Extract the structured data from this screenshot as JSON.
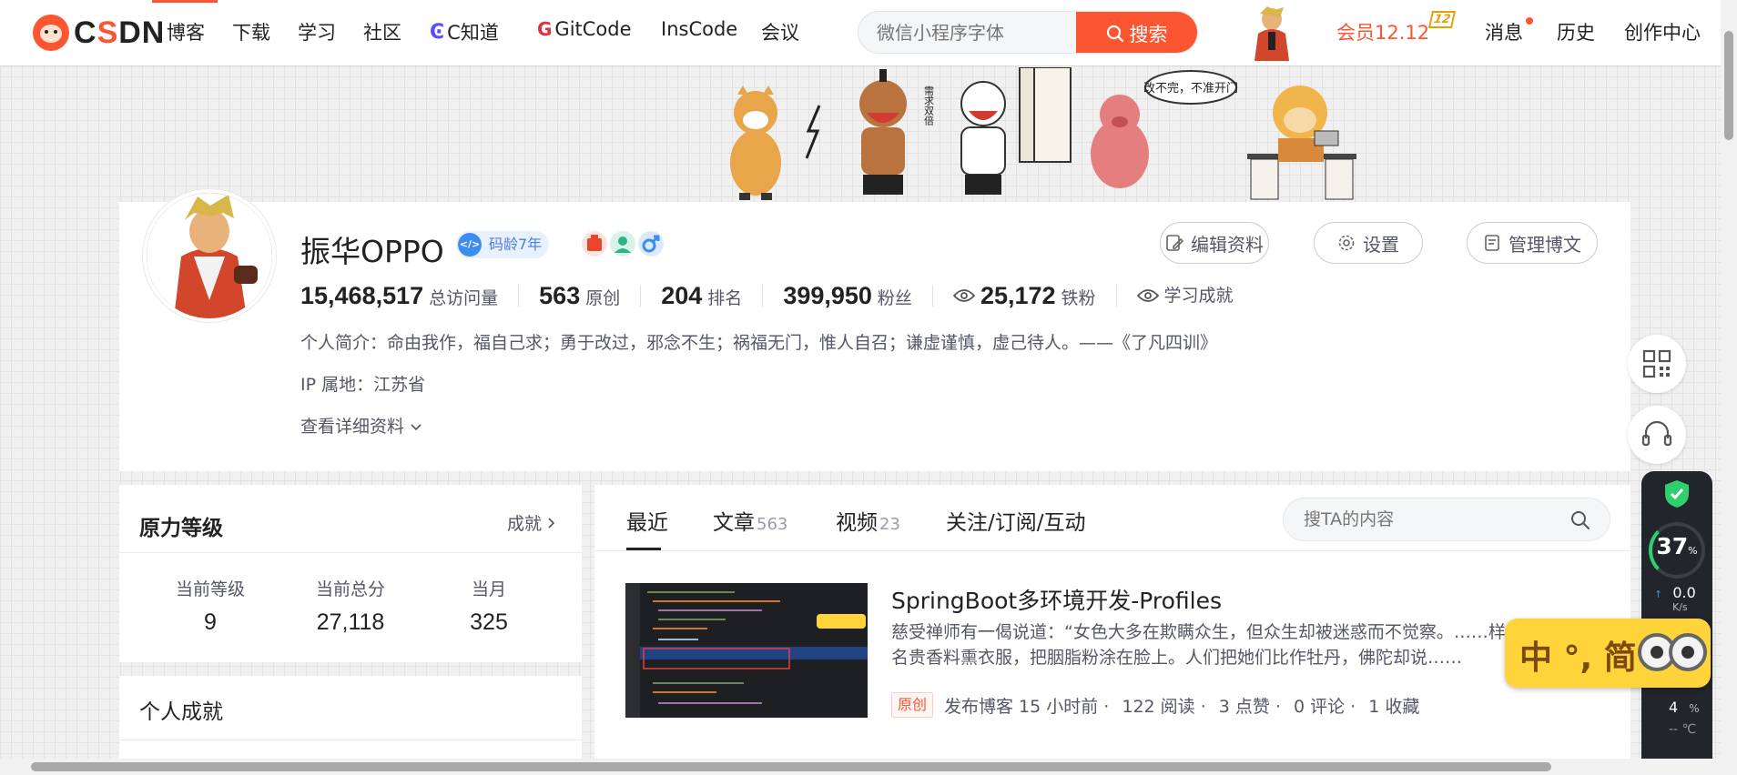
{
  "nav": {
    "items": [
      {
        "label": "博客"
      },
      {
        "label": "下载"
      },
      {
        "label": "学习"
      },
      {
        "label": "社区"
      },
      {
        "label": "C知道"
      },
      {
        "label": "GitCode"
      },
      {
        "label": "InsCode"
      },
      {
        "label": "会议"
      }
    ],
    "search_placeholder": "微信小程序字体",
    "search_button": "搜索",
    "vip_label": "会员12.12",
    "vip_badge": "12",
    "right_items": [
      "消息",
      "历史",
      "创作中心"
    ],
    "accent_color": "#fc5531"
  },
  "banner": {
    "speech": "改不完，不准开门",
    "sign": "需求双倍"
  },
  "profile": {
    "username": "振华OPPO",
    "coding_age": "码龄7年",
    "buttons": [
      "编辑资料",
      "设置",
      "管理博文"
    ],
    "stats": [
      {
        "value": "15,468,517",
        "label": "总访问量"
      },
      {
        "value": "563",
        "label": "原创"
      },
      {
        "value": "204",
        "label": "排名"
      },
      {
        "value": "399,950",
        "label": "粉丝"
      },
      {
        "value": "25,172",
        "label": "铁粉"
      }
    ],
    "learning": "学习成就",
    "intro": "个人简介：命由我作，福自己求；勇于改过，邪念不生；祸福无门，惟人自召；谦虚谨慎，虚己待人。——《了凡四训》",
    "ip": "IP 属地：江苏省",
    "more": "查看详细资料"
  },
  "level": {
    "title": "原力等级",
    "link": "成就",
    "columns": [
      {
        "label": "当前等级",
        "value": "9"
      },
      {
        "label": "当前总分",
        "value": "27,118"
      },
      {
        "label": "当月",
        "value": "325"
      }
    ]
  },
  "achieve": {
    "title": "个人成就"
  },
  "content": {
    "tabs": [
      {
        "label": "最近",
        "count": ""
      },
      {
        "label": "文章",
        "count": "563"
      },
      {
        "label": "视频",
        "count": "23"
      },
      {
        "label": "关注/订阅/互动",
        "count": ""
      }
    ],
    "search_placeholder": "搜TA的内容",
    "article": {
      "title": "SpringBoot多环境开发-Profiles",
      "desc": "慈受禅师有一偈说道：“女色大多在欺瞒众生，但众生却被迷惑而不觉察。……样的名贵香料熏衣服，把胭脂粉涂在脸上。人们把她们比作牡丹，佛陀却说……",
      "tag": "原创",
      "meta": [
        "发布博客 15 小时前 ·",
        "122 阅读 ·",
        "3 点赞 ·",
        "0 评论 ·",
        "1 收藏"
      ]
    }
  },
  "widget": {
    "percent": "37",
    "percent_unit": "%",
    "speed": "0.0",
    "speed_unit": "K/s",
    "bottom_value": "4",
    "bottom_unit": "%",
    "temp": "-- ℃"
  },
  "ime": {
    "label": "中 °, 简"
  }
}
